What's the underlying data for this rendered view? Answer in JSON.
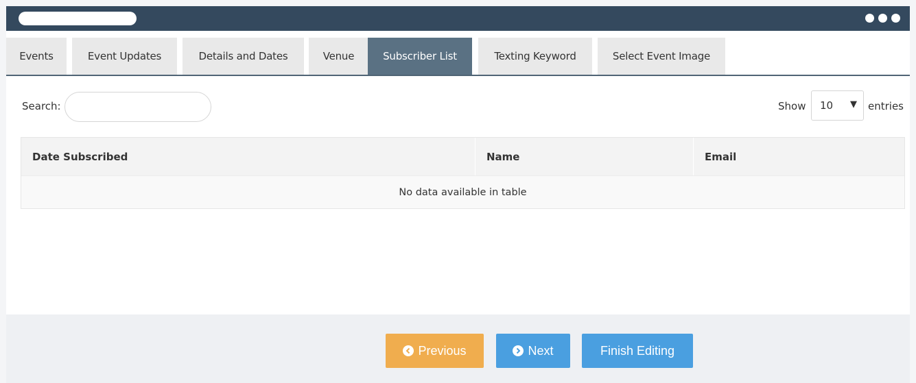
{
  "tabs": [
    {
      "label": "Events"
    },
    {
      "label": "Event Updates"
    },
    {
      "label": "Details and Dates"
    },
    {
      "label": "Venue"
    },
    {
      "label": "Subscriber List",
      "active": true
    },
    {
      "label": "Texting Keyword"
    },
    {
      "label": "Select Event Image"
    }
  ],
  "search": {
    "label": "Search:",
    "value": "",
    "placeholder": ""
  },
  "length": {
    "show_label": "Show",
    "value": "10",
    "entries_label": "entries"
  },
  "table": {
    "columns": [
      "Date Subscribed",
      "Name",
      "Email"
    ],
    "empty_message": "No data available in table"
  },
  "buttons": {
    "previous": "Previous",
    "next": "Next",
    "finish": "Finish Editing"
  },
  "icons": {
    "previous": "arrow-circle-left-icon",
    "next": "arrow-circle-right-icon",
    "caret": "caret-down-icon",
    "menu": "more-dots-icon"
  },
  "colors": {
    "titlebar": "#34495e",
    "active_tab": "#5a7183",
    "previous_button": "#f0ad4e",
    "primary_button": "#4a9fe0"
  }
}
